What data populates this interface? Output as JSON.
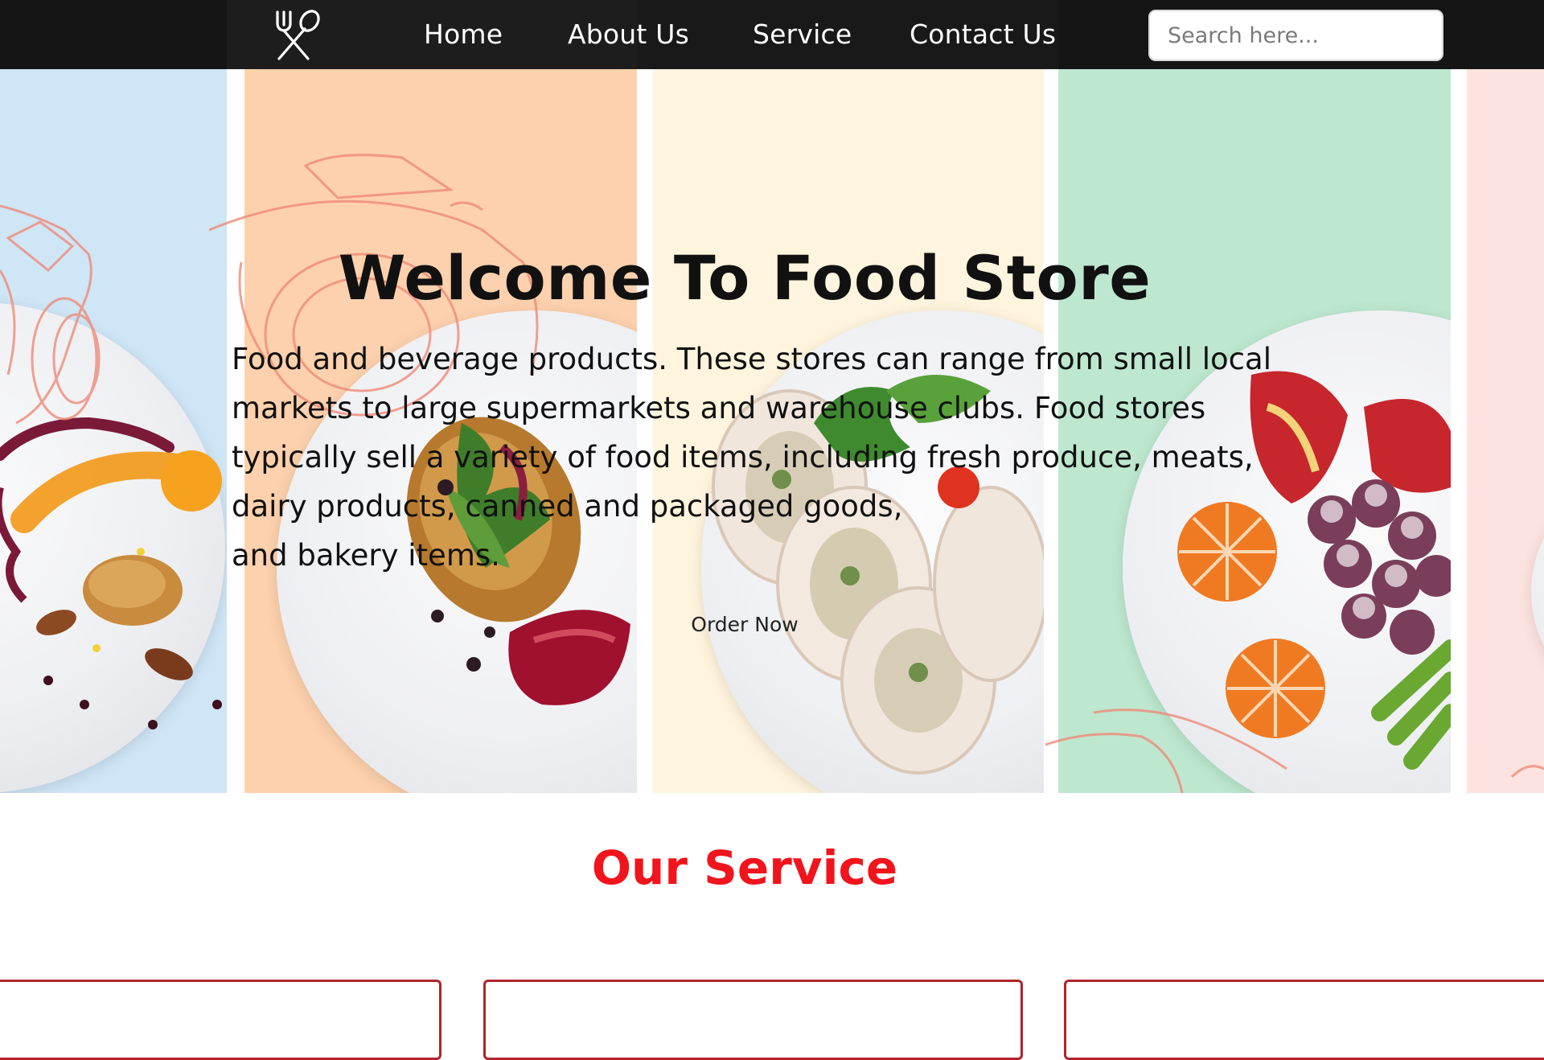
{
  "nav": {
    "logo_icon": "fork-and-spoon-icon",
    "links": [
      "Home",
      "About Us",
      "Service",
      "Contact Us"
    ],
    "search_placeholder": "Search here..."
  },
  "hero": {
    "title": "Welcome To Food Store",
    "paragraph_lines": [
      "Food and beverage products. These stores can range from small local",
      "markets to large supermarkets and warehouse clubs. Food stores",
      "typically sell a variety of food items, including fresh produce, meats,",
      "dairy products, canned and packaged goods,",
      "and bakery items."
    ],
    "order_button": "Order Now",
    "panel_colors": [
      "#cfe6f6",
      "#fdd1ad",
      "#fff4dd",
      "#bde8cf",
      "#fde3e0"
    ]
  },
  "services": {
    "title": "Our Service",
    "accent_color": "#f1141c"
  }
}
